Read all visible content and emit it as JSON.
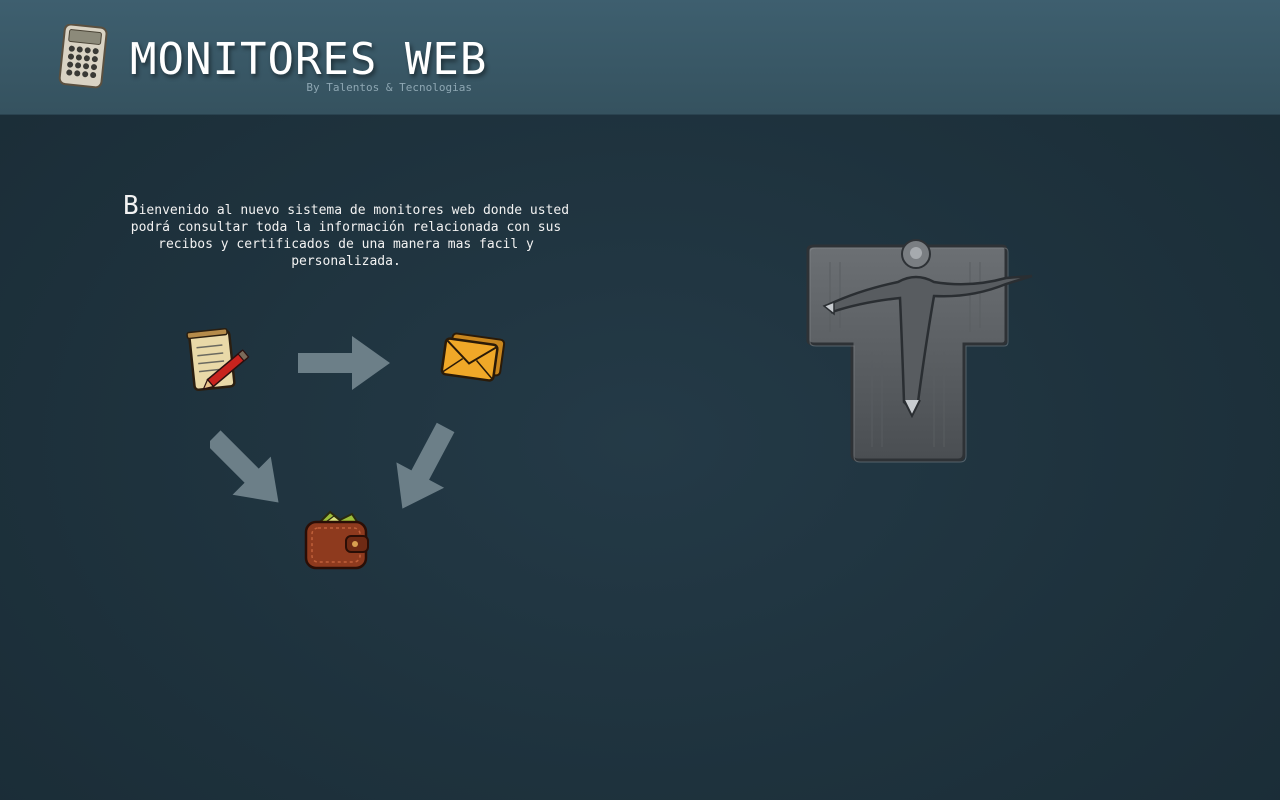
{
  "header": {
    "title": "MONITORES WEB",
    "subtitle": "By Talentos & Tecnologias",
    "logo_icon": "calculator-icon"
  },
  "welcome": {
    "dropcap": "B",
    "text": "ienvenido al nuevo sistema de monitores web donde usted podrá consultar toda la información relacionada con sus recibos y certificados de una manera mas facil y personalizada."
  },
  "flow": {
    "icons": [
      "notepad-pencil-icon",
      "envelope-icon",
      "wallet-icon"
    ],
    "arrows": [
      "arrow-right-icon",
      "arrow-down-right-icon",
      "arrow-down-left-icon"
    ]
  },
  "emblem": {
    "icon": "t-figure-emblem-icon"
  },
  "colors": {
    "header_bg": "#3a5a69",
    "body_bg": "#1f3440",
    "text": "#ffffff",
    "subtitle": "#8ea7b3",
    "arrow": "#6c7f88"
  }
}
